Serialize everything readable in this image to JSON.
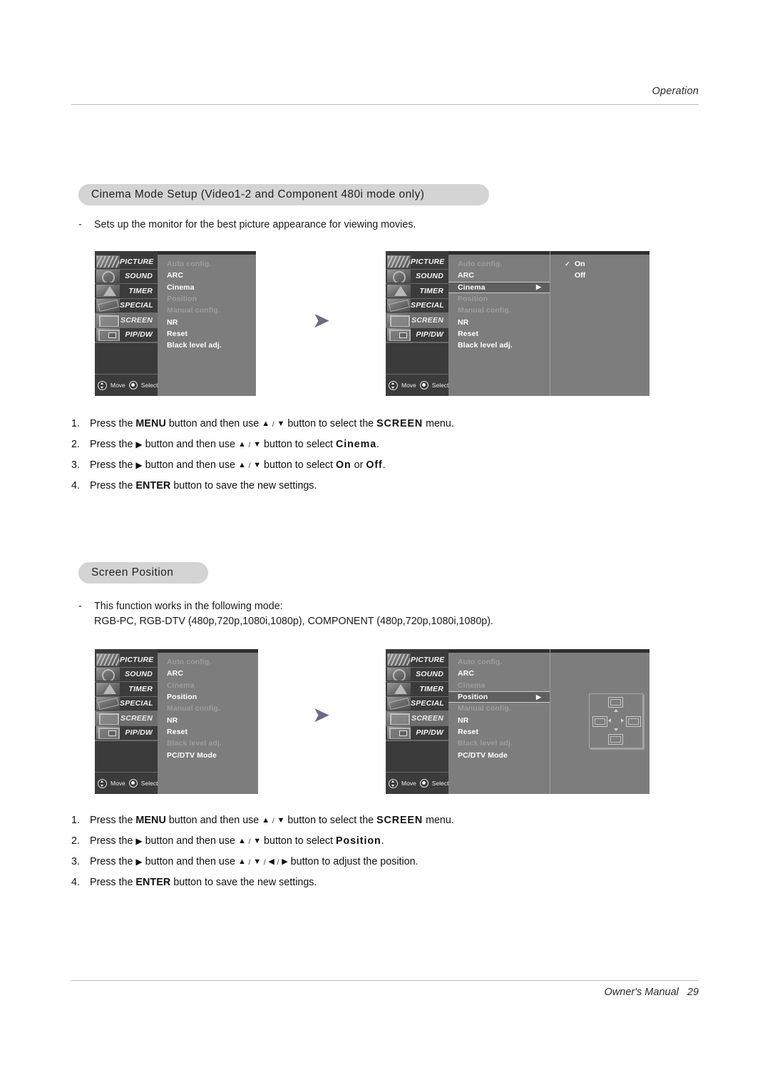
{
  "page": {
    "running_head": "Operation",
    "footer_label": "Owner's Manual",
    "footer_page": "29"
  },
  "sections": [
    {
      "heading": "Cinema Mode Setup (Video1-2 and Component 480i mode only)",
      "dash": "-",
      "description": "Sets up the monitor for the best picture appearance for viewing movies."
    },
    {
      "heading": "Screen Position",
      "dash": "-",
      "description_line1": "This function works in the following mode:",
      "description_line2": "RGB-PC, RGB-DTV (480p,720p,1080i,1080p), COMPONENT (480p,720p,1080i,1080p)."
    }
  ],
  "osd": {
    "rail": [
      {
        "label": "PICTURE",
        "icon": "film-strip-icon"
      },
      {
        "label": "SOUND",
        "icon": "speaker-icon"
      },
      {
        "label": "TIMER",
        "icon": "hourglass-icon"
      },
      {
        "label": "SPECIAL",
        "icon": "tools-icon"
      },
      {
        "label": "SCREEN",
        "icon": "monitor-icon"
      },
      {
        "label": "PIP/DW",
        "icon": "pip-icon"
      }
    ],
    "footer": {
      "move_label": "Move",
      "select_label": "Select",
      "move_icon": "dpad-icon",
      "select_icon": "enter-button-icon"
    },
    "arrow_glyph": "▶",
    "check_glyph": "✓"
  },
  "menu1": {
    "selected_rail": "SCREEN",
    "items": [
      {
        "label": "Auto config.",
        "state": "dim"
      },
      {
        "label": "ARC",
        "state": "normal"
      },
      {
        "label": "Cinema",
        "state": "normal"
      },
      {
        "label": "Position",
        "state": "dim"
      },
      {
        "label": "Manual config.",
        "state": "dim"
      },
      {
        "label": "NR",
        "state": "normal"
      },
      {
        "label": "Reset",
        "state": "normal"
      },
      {
        "label": "Black level adj.",
        "state": "normal"
      }
    ]
  },
  "menu2": {
    "selected_rail": "SCREEN",
    "items": [
      {
        "label": "Auto config.",
        "state": "dim"
      },
      {
        "label": "ARC",
        "state": "normal"
      },
      {
        "label": "Cinema",
        "state": "highlight"
      },
      {
        "label": "Position",
        "state": "dim"
      },
      {
        "label": "Manual config.",
        "state": "dim"
      },
      {
        "label": "NR",
        "state": "normal"
      },
      {
        "label": "Reset",
        "state": "normal"
      },
      {
        "label": "Black level adj.",
        "state": "normal"
      }
    ],
    "submenu": [
      {
        "label": "On",
        "checked": true
      },
      {
        "label": "Off",
        "checked": false
      }
    ]
  },
  "menu3": {
    "selected_rail": "SCREEN",
    "items": [
      {
        "label": "Auto config.",
        "state": "dim"
      },
      {
        "label": "ARC",
        "state": "normal"
      },
      {
        "label": "Cinema",
        "state": "dim"
      },
      {
        "label": "Position",
        "state": "normal"
      },
      {
        "label": "Manual config.",
        "state": "dim"
      },
      {
        "label": "NR",
        "state": "normal"
      },
      {
        "label": "Reset",
        "state": "normal"
      },
      {
        "label": "Black level adj.",
        "state": "dim"
      },
      {
        "label": "PC/DTV Mode",
        "state": "normal"
      }
    ]
  },
  "menu4": {
    "selected_rail": "SCREEN",
    "items": [
      {
        "label": "Auto config.",
        "state": "dim"
      },
      {
        "label": "ARC",
        "state": "normal"
      },
      {
        "label": "Cinema",
        "state": "dim"
      },
      {
        "label": "Position",
        "state": "highlight"
      },
      {
        "label": "Manual config.",
        "state": "dim"
      },
      {
        "label": "NR",
        "state": "normal"
      },
      {
        "label": "Reset",
        "state": "normal"
      },
      {
        "label": "Black level adj.",
        "state": "dim"
      },
      {
        "label": "PC/DTV Mode",
        "state": "normal"
      }
    ],
    "position_widget": "screen-position-adjust-icon"
  },
  "steps_cinema": [
    {
      "num": "1.",
      "parts": [
        {
          "t": "Press the ",
          "s": "plain"
        },
        {
          "t": "MENU",
          "s": "bold"
        },
        {
          "t": " button and then use ",
          "s": "plain"
        },
        {
          "t": "▲",
          "s": "glyph"
        },
        {
          "t": " / ",
          "s": "sep"
        },
        {
          "t": "▼",
          "s": "glyph"
        },
        {
          "t": " button to select the ",
          "s": "plain"
        },
        {
          "t": "SCREEN",
          "s": "wide"
        },
        {
          "t": " menu.",
          "s": "plain"
        }
      ]
    },
    {
      "num": "2.",
      "parts": [
        {
          "t": "Press the ",
          "s": "plain"
        },
        {
          "t": "▶",
          "s": "glyphr"
        },
        {
          "t": " button and then use ",
          "s": "plain"
        },
        {
          "t": "▲",
          "s": "glyph"
        },
        {
          "t": " / ",
          "s": "sep"
        },
        {
          "t": "▼",
          "s": "glyph"
        },
        {
          "t": " button to select ",
          "s": "plain"
        },
        {
          "t": "Cinema",
          "s": "wide"
        },
        {
          "t": ".",
          "s": "plain"
        }
      ]
    },
    {
      "num": "3.",
      "parts": [
        {
          "t": "Press the ",
          "s": "plain"
        },
        {
          "t": "▶",
          "s": "glyphr"
        },
        {
          "t": " button and then use ",
          "s": "plain"
        },
        {
          "t": "▲",
          "s": "glyph"
        },
        {
          "t": " / ",
          "s": "sep"
        },
        {
          "t": "▼",
          "s": "glyph"
        },
        {
          "t": " button to select ",
          "s": "plain"
        },
        {
          "t": "On",
          "s": "wide"
        },
        {
          "t": " or ",
          "s": "plain"
        },
        {
          "t": "Off",
          "s": "wide"
        },
        {
          "t": ".",
          "s": "plain"
        }
      ]
    },
    {
      "num": "4.",
      "parts": [
        {
          "t": "Press the ",
          "s": "plain"
        },
        {
          "t": "ENTER",
          "s": "bold"
        },
        {
          "t": " button to save the new settings.",
          "s": "plain"
        }
      ]
    }
  ],
  "steps_position": [
    {
      "num": "1.",
      "parts": [
        {
          "t": "Press the ",
          "s": "plain"
        },
        {
          "t": "MENU",
          "s": "bold"
        },
        {
          "t": " button and then use ",
          "s": "plain"
        },
        {
          "t": "▲",
          "s": "glyph"
        },
        {
          "t": " / ",
          "s": "sep"
        },
        {
          "t": "▼",
          "s": "glyph"
        },
        {
          "t": " button to select the ",
          "s": "plain"
        },
        {
          "t": "SCREEN",
          "s": "wide"
        },
        {
          "t": " menu.",
          "s": "plain"
        }
      ]
    },
    {
      "num": "2.",
      "parts": [
        {
          "t": "Press the ",
          "s": "plain"
        },
        {
          "t": "▶",
          "s": "glyphr"
        },
        {
          "t": " button and then use ",
          "s": "plain"
        },
        {
          "t": "▲",
          "s": "glyph"
        },
        {
          "t": " / ",
          "s": "sep"
        },
        {
          "t": "▼",
          "s": "glyph"
        },
        {
          "t": " button to select ",
          "s": "plain"
        },
        {
          "t": "Position",
          "s": "wide"
        },
        {
          "t": ".",
          "s": "plain"
        }
      ]
    },
    {
      "num": "3.",
      "parts": [
        {
          "t": "Press the ",
          "s": "plain"
        },
        {
          "t": "▶",
          "s": "glyphr"
        },
        {
          "t": " button and then use ",
          "s": "plain"
        },
        {
          "t": "▲",
          "s": "glyph"
        },
        {
          "t": " / ",
          "s": "sep"
        },
        {
          "t": "▼",
          "s": "glyph"
        },
        {
          "t": " / ",
          "s": "sep"
        },
        {
          "t": "◀",
          "s": "glyph"
        },
        {
          "t": " / ",
          "s": "sep"
        },
        {
          "t": "▶",
          "s": "glyph"
        },
        {
          "t": " button to adjust the position.",
          "s": "plain"
        }
      ]
    },
    {
      "num": "4.",
      "parts": [
        {
          "t": "Press the ",
          "s": "plain"
        },
        {
          "t": "ENTER",
          "s": "bold"
        },
        {
          "t": " button to save the new settings.",
          "s": "plain"
        }
      ]
    }
  ]
}
